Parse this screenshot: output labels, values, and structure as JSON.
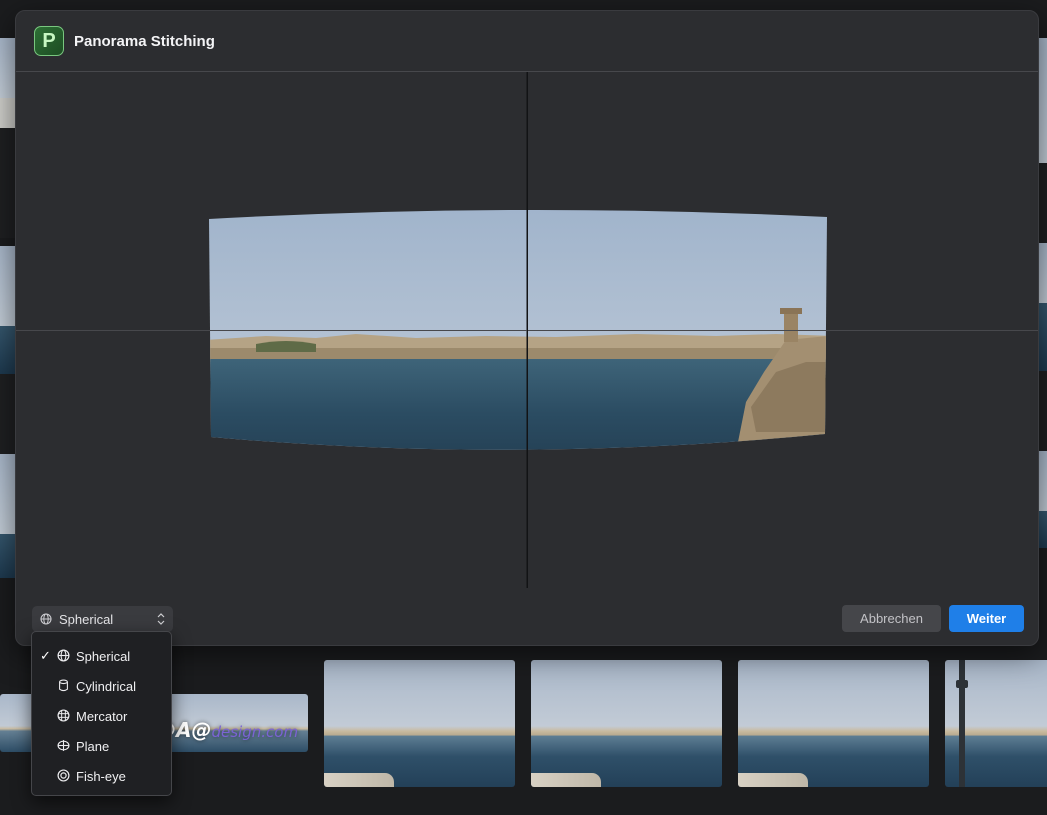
{
  "dialog": {
    "logo_letter": "P",
    "title": "Panorama Stitching"
  },
  "projection": {
    "selected": "Spherical",
    "options": [
      {
        "label": "Spherical",
        "icon": "globe-icon",
        "checked": true
      },
      {
        "label": "Cylindrical",
        "icon": "cylinder-icon",
        "checked": false
      },
      {
        "label": "Mercator",
        "icon": "mercator-grid-icon",
        "checked": false
      },
      {
        "label": "Plane",
        "icon": "plane-icon",
        "checked": false
      },
      {
        "label": "Fish-eye",
        "icon": "fisheye-icon",
        "checked": false
      }
    ],
    "check_mark": "✓"
  },
  "buttons": {
    "cancel": "Abbrechen",
    "next": "Weiter"
  },
  "watermark": {
    "prefix": "@A@",
    "suffix": "design.com"
  },
  "colors": {
    "accent": "#1f7fe8",
    "dialog_bg": "#2c2d30",
    "logo_green": "#2d6f35"
  }
}
